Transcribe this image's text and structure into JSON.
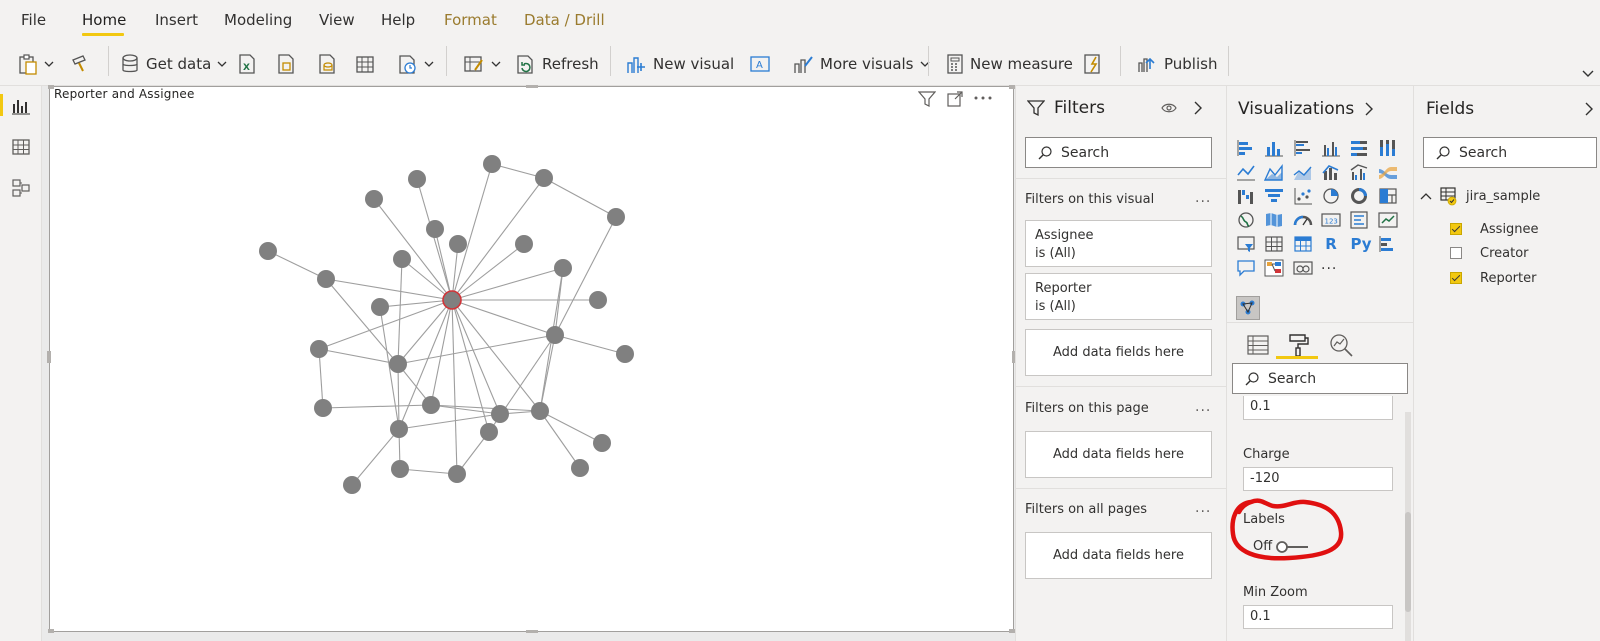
{
  "menu": {
    "items": [
      "File",
      "Home",
      "Insert",
      "Modeling",
      "View",
      "Help",
      "Format",
      "Data / Drill"
    ],
    "active": "Home"
  },
  "ribbon": {
    "get_data": "Get data",
    "refresh": "Refresh",
    "new_visual": "New visual",
    "more_visuals": "More visuals",
    "new_measure": "New measure",
    "publish": "Publish"
  },
  "visual": {
    "title": "Reporter and Assignee"
  },
  "filters": {
    "title": "Filters",
    "search_placeholder": "Search",
    "on_visual_label": "Filters on this visual",
    "visual_filters": [
      {
        "field": "Assignee",
        "state": "is (All)"
      },
      {
        "field": "Reporter",
        "state": "is (All)"
      }
    ],
    "add_fields": "Add data fields here",
    "on_page_label": "Filters on this page",
    "on_all_pages_label": "Filters on all pages",
    "more": "..."
  },
  "visualizations": {
    "title": "Visualizations",
    "r_label": "R",
    "py_label": "Py",
    "more": "...",
    "search_placeholder": "Search",
    "props": {
      "top_value": "0.1",
      "charge_label": "Charge",
      "charge_value": "-120",
      "labels_label": "Labels",
      "labels_state": "Off",
      "min_zoom_label": "Min Zoom",
      "min_zoom_value": "0.1"
    },
    "annotation_color": "#e01010"
  },
  "fields": {
    "title": "Fields",
    "search_placeholder": "Search",
    "table": "jira_sample",
    "items": [
      {
        "name": "Assignee",
        "checked": true
      },
      {
        "name": "Creator",
        "checked": false
      },
      {
        "name": "Reporter",
        "checked": true
      }
    ]
  },
  "colors": {
    "accent": "#f2c811",
    "node": "#808080",
    "selected_node_border": "#d13438",
    "edge": "#9e9e9e"
  }
}
